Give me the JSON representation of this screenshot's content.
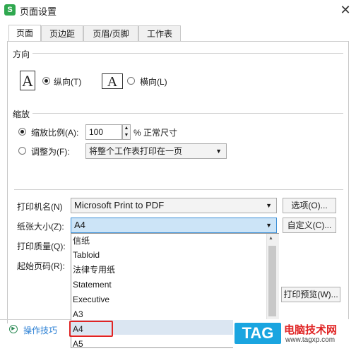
{
  "window": {
    "app_icon_letter": "S",
    "title": "页面设置",
    "close": "✕"
  },
  "tabs": [
    {
      "label": "页面"
    },
    {
      "label": "页边距"
    },
    {
      "label": "页眉/页脚"
    },
    {
      "label": "工作表"
    }
  ],
  "orientation": {
    "group": "方向",
    "portrait_glyph": "A",
    "portrait_label": "纵向(T)",
    "landscape_glyph": "A",
    "landscape_label": "横向(L)"
  },
  "scaling": {
    "group": "缩放",
    "scale_label": "缩放比例(A):",
    "scale_value": "100",
    "scale_suffix": "% 正常尺寸",
    "fit_label": "调整为(F):",
    "fit_value": "将整个工作表打印在一页"
  },
  "printer": {
    "printer_label": "打印机名(N)",
    "printer_value": "Microsoft Print to PDF",
    "options_button": "选项(O)...",
    "paper_label": "纸张大小(Z):",
    "paper_value": "A4",
    "custom_button": "自定义(C)...",
    "quality_label": "打印质量(Q):",
    "first_page_label": "起始页码(R):",
    "preview_button": "打印预览(W)..."
  },
  "paper_options": [
    "信纸",
    "Tabloid",
    "法律专用纸",
    "Statement",
    "Executive",
    "A3",
    "A4",
    "A5"
  ],
  "footer": {
    "tips": "操作技巧"
  },
  "watermark": {
    "tag": "TAG",
    "site": "电脑技术网",
    "url": "www.tagxp.com"
  },
  "colors": {
    "accent": "#cce4f7",
    "highlight_box": "#e02424",
    "brand_green": "#2fa84f"
  }
}
